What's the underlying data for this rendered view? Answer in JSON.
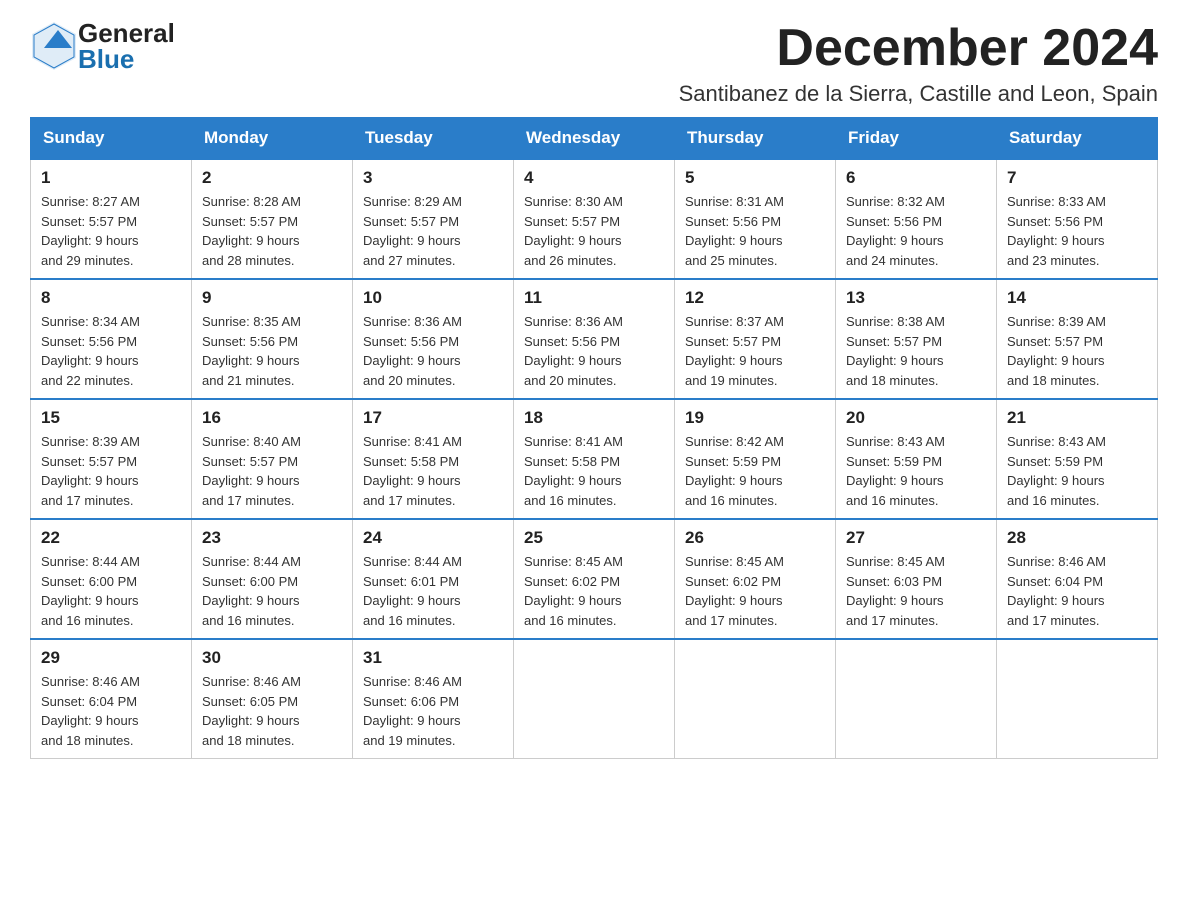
{
  "header": {
    "logo_general": "General",
    "logo_blue": "Blue",
    "main_title": "December 2024",
    "subtitle": "Santibanez de la Sierra, Castille and Leon, Spain"
  },
  "calendar": {
    "days_of_week": [
      "Sunday",
      "Monday",
      "Tuesday",
      "Wednesday",
      "Thursday",
      "Friday",
      "Saturday"
    ],
    "weeks": [
      [
        {
          "day": "1",
          "sunrise": "8:27 AM",
          "sunset": "5:57 PM",
          "daylight": "9 hours and 29 minutes."
        },
        {
          "day": "2",
          "sunrise": "8:28 AM",
          "sunset": "5:57 PM",
          "daylight": "9 hours and 28 minutes."
        },
        {
          "day": "3",
          "sunrise": "8:29 AM",
          "sunset": "5:57 PM",
          "daylight": "9 hours and 27 minutes."
        },
        {
          "day": "4",
          "sunrise": "8:30 AM",
          "sunset": "5:57 PM",
          "daylight": "9 hours and 26 minutes."
        },
        {
          "day": "5",
          "sunrise": "8:31 AM",
          "sunset": "5:56 PM",
          "daylight": "9 hours and 25 minutes."
        },
        {
          "day": "6",
          "sunrise": "8:32 AM",
          "sunset": "5:56 PM",
          "daylight": "9 hours and 24 minutes."
        },
        {
          "day": "7",
          "sunrise": "8:33 AM",
          "sunset": "5:56 PM",
          "daylight": "9 hours and 23 minutes."
        }
      ],
      [
        {
          "day": "8",
          "sunrise": "8:34 AM",
          "sunset": "5:56 PM",
          "daylight": "9 hours and 22 minutes."
        },
        {
          "day": "9",
          "sunrise": "8:35 AM",
          "sunset": "5:56 PM",
          "daylight": "9 hours and 21 minutes."
        },
        {
          "day": "10",
          "sunrise": "8:36 AM",
          "sunset": "5:56 PM",
          "daylight": "9 hours and 20 minutes."
        },
        {
          "day": "11",
          "sunrise": "8:36 AM",
          "sunset": "5:56 PM",
          "daylight": "9 hours and 20 minutes."
        },
        {
          "day": "12",
          "sunrise": "8:37 AM",
          "sunset": "5:57 PM",
          "daylight": "9 hours and 19 minutes."
        },
        {
          "day": "13",
          "sunrise": "8:38 AM",
          "sunset": "5:57 PM",
          "daylight": "9 hours and 18 minutes."
        },
        {
          "day": "14",
          "sunrise": "8:39 AM",
          "sunset": "5:57 PM",
          "daylight": "9 hours and 18 minutes."
        }
      ],
      [
        {
          "day": "15",
          "sunrise": "8:39 AM",
          "sunset": "5:57 PM",
          "daylight": "9 hours and 17 minutes."
        },
        {
          "day": "16",
          "sunrise": "8:40 AM",
          "sunset": "5:57 PM",
          "daylight": "9 hours and 17 minutes."
        },
        {
          "day": "17",
          "sunrise": "8:41 AM",
          "sunset": "5:58 PM",
          "daylight": "9 hours and 17 minutes."
        },
        {
          "day": "18",
          "sunrise": "8:41 AM",
          "sunset": "5:58 PM",
          "daylight": "9 hours and 16 minutes."
        },
        {
          "day": "19",
          "sunrise": "8:42 AM",
          "sunset": "5:59 PM",
          "daylight": "9 hours and 16 minutes."
        },
        {
          "day": "20",
          "sunrise": "8:43 AM",
          "sunset": "5:59 PM",
          "daylight": "9 hours and 16 minutes."
        },
        {
          "day": "21",
          "sunrise": "8:43 AM",
          "sunset": "5:59 PM",
          "daylight": "9 hours and 16 minutes."
        }
      ],
      [
        {
          "day": "22",
          "sunrise": "8:44 AM",
          "sunset": "6:00 PM",
          "daylight": "9 hours and 16 minutes."
        },
        {
          "day": "23",
          "sunrise": "8:44 AM",
          "sunset": "6:00 PM",
          "daylight": "9 hours and 16 minutes."
        },
        {
          "day": "24",
          "sunrise": "8:44 AM",
          "sunset": "6:01 PM",
          "daylight": "9 hours and 16 minutes."
        },
        {
          "day": "25",
          "sunrise": "8:45 AM",
          "sunset": "6:02 PM",
          "daylight": "9 hours and 16 minutes."
        },
        {
          "day": "26",
          "sunrise": "8:45 AM",
          "sunset": "6:02 PM",
          "daylight": "9 hours and 17 minutes."
        },
        {
          "day": "27",
          "sunrise": "8:45 AM",
          "sunset": "6:03 PM",
          "daylight": "9 hours and 17 minutes."
        },
        {
          "day": "28",
          "sunrise": "8:46 AM",
          "sunset": "6:04 PM",
          "daylight": "9 hours and 17 minutes."
        }
      ],
      [
        {
          "day": "29",
          "sunrise": "8:46 AM",
          "sunset": "6:04 PM",
          "daylight": "9 hours and 18 minutes."
        },
        {
          "day": "30",
          "sunrise": "8:46 AM",
          "sunset": "6:05 PM",
          "daylight": "9 hours and 18 minutes."
        },
        {
          "day": "31",
          "sunrise": "8:46 AM",
          "sunset": "6:06 PM",
          "daylight": "9 hours and 19 minutes."
        },
        null,
        null,
        null,
        null
      ]
    ]
  }
}
